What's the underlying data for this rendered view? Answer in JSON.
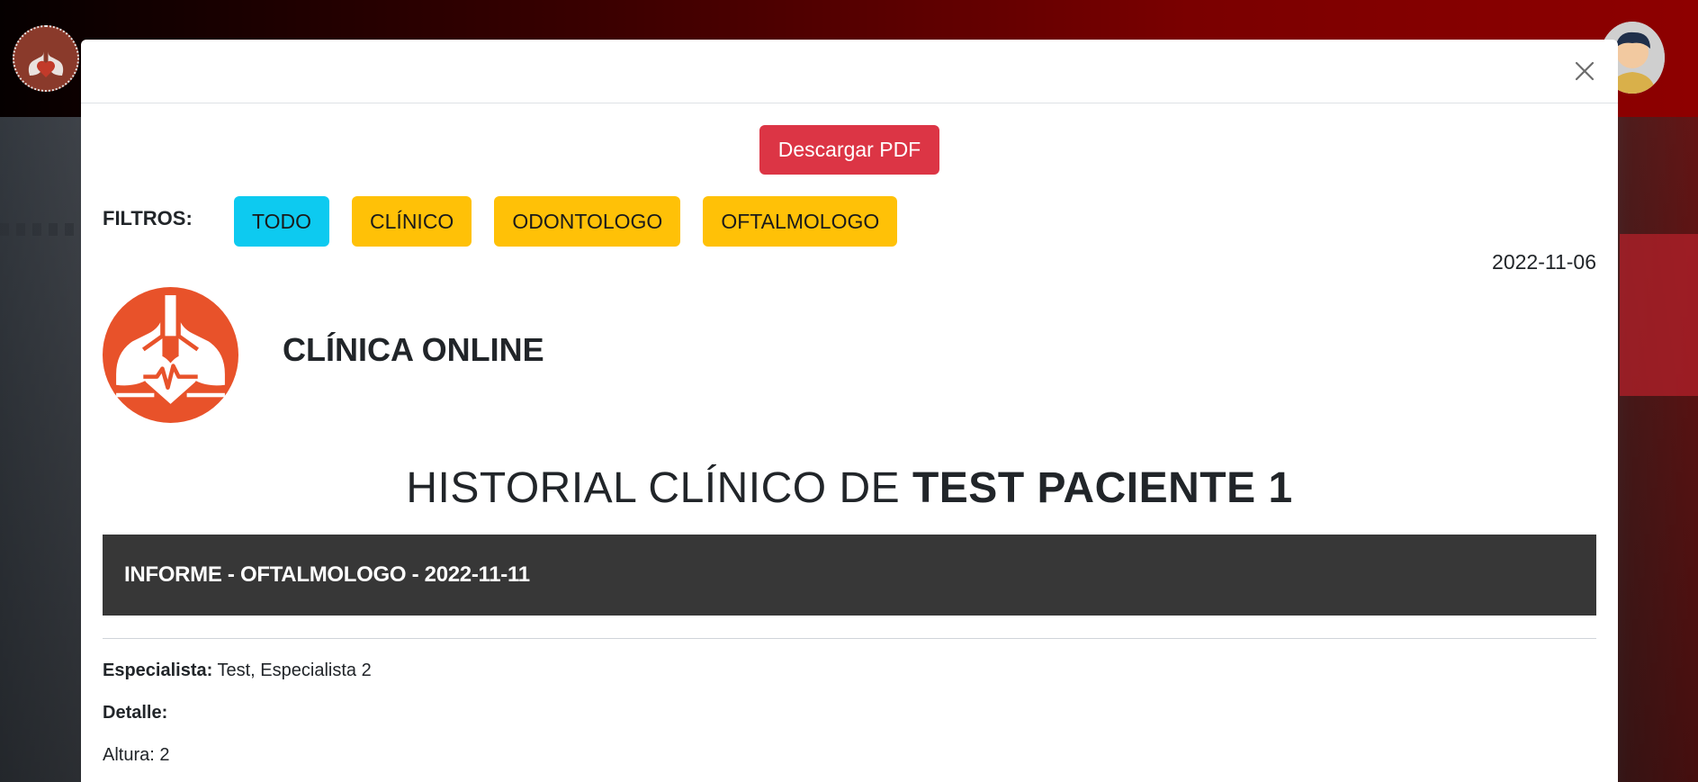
{
  "modal": {
    "download_pdf_label": "Descargar PDF",
    "filters_label": "FILTROS:",
    "filters": [
      "TODO",
      "CLÍNICO",
      "ODONTOLOGO",
      "OFTALMOLOGO"
    ],
    "active_filter": "TODO",
    "date": "2022-11-06",
    "clinic_name": "CLÍNICA ONLINE",
    "history_prefix": "HISTORIAL CLÍNICO DE",
    "patient_name": "TEST PACIENTE 1",
    "report_title": "INFORME - OFTALMOLOGO - 2022-11-11",
    "specialist_label": "Especialista:",
    "specialist_value": "Test, Especialista 2",
    "detail_label": "Detalle:",
    "height_label": "Altura:",
    "height_value": "2"
  },
  "icons": {
    "close": "close-icon",
    "clinic_logo": "lungs-heart-logo",
    "app_logo": "lungs-heart-logo",
    "avatar": "user-avatar"
  },
  "colors": {
    "danger": "#dc3545",
    "info": "#0dcaf0",
    "warning": "#ffc107",
    "logo_orange": "#e8522a",
    "report_bar": "#373737"
  }
}
